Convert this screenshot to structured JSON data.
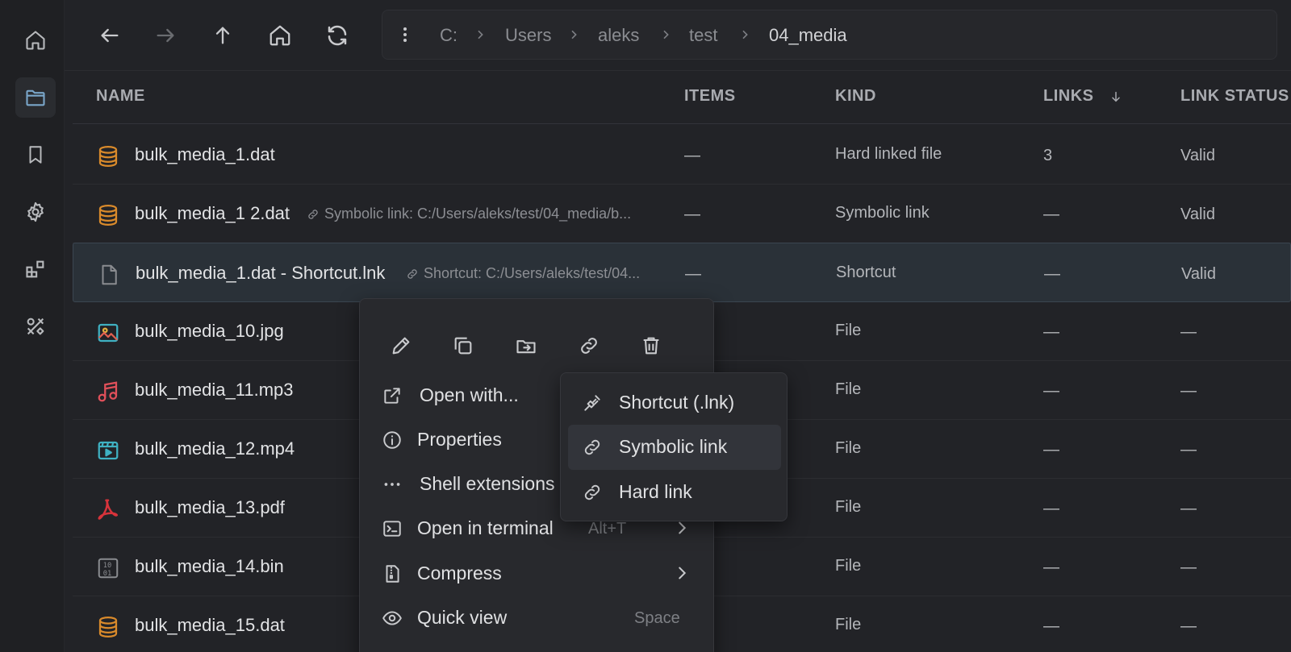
{
  "sidebar": {
    "items": [
      {
        "icon": "home-icon"
      },
      {
        "icon": "folder-icon",
        "active": true
      },
      {
        "icon": "bookmark-icon"
      },
      {
        "icon": "gear-icon"
      },
      {
        "icon": "extensions-icon"
      },
      {
        "icon": "tools-icon"
      }
    ]
  },
  "toolbar": {
    "buttons": [
      "back-arrow-icon",
      "forward-arrow-icon",
      "up-arrow-icon",
      "home-icon",
      "refresh-icon"
    ]
  },
  "breadcrumb": {
    "segments": [
      "C:",
      "Users",
      "aleks",
      "test",
      "04_media"
    ]
  },
  "columns": {
    "name": "NAME",
    "items": "ITEMS",
    "kind": "KIND",
    "links": "LINKS",
    "link_status": "LINK STATUS"
  },
  "rows": [
    {
      "name": "bulk_media_1.dat",
      "icon": "database-icon",
      "link_info": "",
      "items": "—",
      "kind": "Hard linked file",
      "links": "3",
      "status": "Valid"
    },
    {
      "name": "bulk_media_1 2.dat",
      "icon": "database-icon",
      "link_info": "Symbolic link: C:/Users/aleks/test/04_media/b...",
      "items": "—",
      "kind": "Symbolic link",
      "links": "—",
      "status": "Valid"
    },
    {
      "name": "bulk_media_1.dat - Shortcut.lnk",
      "icon": "file-icon",
      "link_info": "Shortcut: C:/Users/aleks/test/04...",
      "items": "—",
      "kind": "Shortcut",
      "links": "—",
      "status": "Valid",
      "selected": true
    },
    {
      "name": "bulk_media_10.jpg",
      "icon": "image-icon",
      "link_info": "",
      "items": "",
      "kind": "File",
      "links": "—",
      "status": "—"
    },
    {
      "name": "bulk_media_11.mp3",
      "icon": "music-icon",
      "link_info": "",
      "items": "",
      "kind": "File",
      "links": "—",
      "status": "—"
    },
    {
      "name": "bulk_media_12.mp4",
      "icon": "video-icon",
      "link_info": "",
      "items": "",
      "kind": "File",
      "links": "—",
      "status": "—"
    },
    {
      "name": "bulk_media_13.pdf",
      "icon": "pdf-icon",
      "link_info": "",
      "items": "",
      "kind": "File",
      "links": "—",
      "status": "—"
    },
    {
      "name": "bulk_media_14.bin",
      "icon": "binary-icon",
      "link_info": "",
      "items": "",
      "kind": "File",
      "links": "—",
      "status": "—"
    },
    {
      "name": "bulk_media_15.dat",
      "icon": "database-icon",
      "link_info": "",
      "items": "",
      "kind": "File",
      "links": "—",
      "status": "—"
    }
  ],
  "context_menu": {
    "quick_actions": [
      "rename-pencil-icon",
      "copy-icon",
      "move-icon",
      "link-icon",
      "trash-icon"
    ],
    "items": [
      {
        "label": "Open with...",
        "icon": "external-open-icon",
        "shortcut": "",
        "submenu": false
      },
      {
        "label": "Properties",
        "icon": "info-icon",
        "shortcut": "",
        "submenu": false
      },
      {
        "label": "Shell extensions",
        "icon": "ellipsis-icon",
        "shortcut": "",
        "submenu": false
      },
      {
        "label": "Open in terminal",
        "icon": "terminal-icon",
        "shortcut": "Alt+T",
        "submenu": true
      },
      {
        "label": "Compress",
        "icon": "archive-icon",
        "shortcut": "",
        "submenu": true
      },
      {
        "label": "Quick view",
        "icon": "eye-icon",
        "shortcut": "Space",
        "submenu": false
      }
    ]
  },
  "link_submenu": {
    "items": [
      {
        "label": "Shortcut (.lnk)",
        "icon": "shortcut-plug-icon"
      },
      {
        "label": "Symbolic link",
        "icon": "link-icon",
        "hover": true
      },
      {
        "label": "Hard link",
        "icon": "link-icon"
      }
    ]
  },
  "colors": {
    "database": "#d98a2b",
    "image": "#3fb1c2",
    "music": "#e0505a",
    "video": "#3fb1c2",
    "pdf": "#d8333b",
    "binary": "#8a8c90",
    "file": "#8a8c90"
  }
}
